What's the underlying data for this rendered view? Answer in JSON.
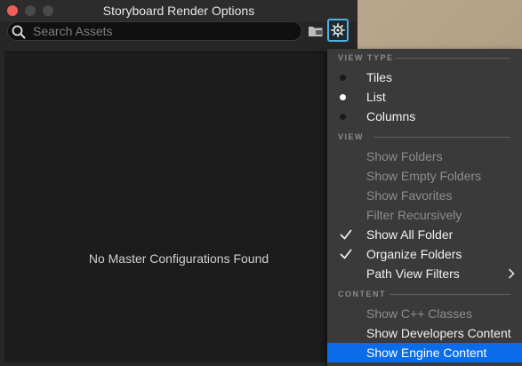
{
  "window": {
    "title": "Storyboard Render Options",
    "search_placeholder": "Search Assets",
    "empty_message": "No Master Configurations Found"
  },
  "menu": {
    "sections": {
      "view_type": "VIEW TYPE",
      "view": "VIEW",
      "content": "CONTENT"
    },
    "view_type_items": [
      {
        "label": "Tiles",
        "selected": false
      },
      {
        "label": "List",
        "selected": true
      },
      {
        "label": "Columns",
        "selected": false
      }
    ],
    "view_items": [
      {
        "label": "Show Folders",
        "enabled": false
      },
      {
        "label": "Show Empty Folders",
        "enabled": false
      },
      {
        "label": "Show Favorites",
        "enabled": false
      },
      {
        "label": "Filter Recursively",
        "enabled": false
      },
      {
        "label": "Show All Folder",
        "enabled": true,
        "checked": true
      },
      {
        "label": "Organize Folders",
        "enabled": true,
        "checked": true
      },
      {
        "label": "Path View Filters",
        "enabled": true,
        "submenu": true
      }
    ],
    "content_items": [
      {
        "label": "Show C++ Classes",
        "enabled": false
      },
      {
        "label": "Show Developers Content",
        "enabled": true
      },
      {
        "label": "Show Engine Content",
        "enabled": true,
        "highlighted": true
      }
    ]
  },
  "colors": {
    "accent": "#0a6ce8",
    "gear_outline": "#4bb3e3",
    "close_button": "#ee5f57"
  }
}
